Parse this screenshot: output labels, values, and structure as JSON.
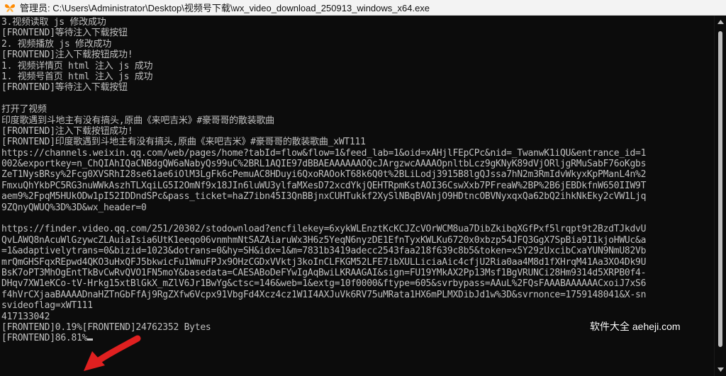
{
  "window": {
    "title": "管理员: C:\\Users\\Administrator\\Desktop\\视频号下载\\wx_video_download_250913_windows_x64.exe"
  },
  "console": {
    "lines": [
      "3.视频读取 js 修改成功",
      "[FRONTEND]等待注入下载按钮",
      "2. 视频播放 js 修改成功",
      "[FRONTEND]注入下载按钮成功!",
      "1. 视频详情页 html 注入 js 成功",
      "1. 视频号首页 html 注入 js 成功",
      "[FRONTEND]等待注入下载按钮",
      "",
      "打开了视频",
      "印度歌遇到斗地主有没有搞头,原曲《来吧吉米》#豪哥哥的散装歌曲",
      "[FRONTEND]注入下载按钮成功!",
      "[FRONTEND]印度歌遇到斗地主有没有搞头,原曲《来吧吉米》#豪哥哥的散装歌曲_xWT111",
      "https://channels.weixin.qq.com/web/pages/home?tabId=flow&flow=1&feed_lab=1&oid=xAHjlFEpCPc&nid=_TwanwK1iQU&entrance_id=1",
      "002&exportkey=n_ChQIAhIQaCNBdgQW6aNabyQs99uC%2BRL1AQIE97dBBAEAAAAAAOQcJArgzwcAAAAOpnltbLcz9gKNyK89dVjORljgRMuSabF76oKgbs",
      "ZeT1NysBRsy%2Fcg0XVSRhI28se61ae6iOlM3LgFk6cPemuAC8HDuyi6QxoRAOokT68k6Q0t%2BLiLodj3915B8lgQJssa7hN2m3RmIdvWkyxKpPManL4n%2",
      "FmxuQhYkbPC5RG3nuWWkAszhTLXqiLG5I2OmNf9x18JIn6luWU3ylfaMXesD72xcdYkjQEHTRpmKstAOI36CswXxb7PFreaW%2BP%2B6jEBDkfnW650IIW9T",
      "aem9%2FpqM5HUkODw1pI52IDDndSPc&pass_ticket=haZ7ibn45I3QnBBjnxCUHTukkf2XySlNBqBVAhjO9HDtncOBVNyxqxQa62bQ2ihkNkEky2cVW1Ljq",
      "9ZQnyQWUQ%3D%3D&wx_header=0",
      "",
      "https://finder.video.qq.com/251/20302/stodownload?encfilekey=6xykWLEnztKcKCJZcVOrWCM8ua7DibZkibqXGfPxf5lrqpt9t2BzdTJkdvU",
      "QvLAWQ8nAcuWlGzywcZLAuiaIsia6UtK1eeqo06vnmhmNtSAZAiaruWx3H6z5YeqN6nyzDE1EfnTyxKWLKu6720x0xbzp54JFQ3GgX7SpBia9I1kjoHWUc&a",
      "=1&adaptivelytrans=0&bizid=1023&dotrans=0&hy=SH&idx=1&m=7831b3419adecc2543faa218f639c8b5&token=x5Y29zUxcibCxaYUN9NmU82Vb",
      "mrQmGHSFqxREpwd4QKO3uHxQFJ5bkwicFu1WmuFPJx9OHzCGDxVVktj3koInCLFKGM52LFE7ibXULLiciaAic4cfjU2Ria0aa4M8d1fXHrqM41Aa3XO4Dk9U",
      "BsK7oPT3MhOgEntTkBvCwRvQVO1FN5moY&basedata=CAESABoDeFYwIgAqBwiLKRAAGAI&sign=FU19YMkAX2Pp13Msf1BgVRUNCi28Hm9314d5XRPB0f4-",
      "DHqv7XW1eKCo-tV-Hrkg15xtBlGkX_mZlV6Jr1BwYg&ctsc=146&web=1&extg=10f0000&ftype=605&svrbypass=AAuL%2FQsFAAABAAAAAACxoiJ7xS6",
      "f4hVrCXjaaBAAAADnaHZTnGbFfAj9RgZXfw6Vcpx91VbgFd4Xcz4cz1W1I4AXJuVk6RV75uMRata1HX6mPLMXDibJd1w%3D&svrnonce=1759148041&X-sn",
      "svideoflag=xWT111",
      "417133042",
      "[FRONTEND]0.19%[FRONTEND]24762352 Bytes",
      "[FRONTEND]86.81%"
    ]
  },
  "watermark": {
    "text": "软件大全 aeheji.com"
  },
  "icons": {
    "app": "butterfly-app-icon",
    "pointer": "red-arrow-annotation-icon"
  },
  "colors": {
    "console_bg": "#0c0c0c",
    "console_fg": "#c0c0c0",
    "titlebar_bg": "#f3f3f3",
    "arrow": "#e02020"
  }
}
